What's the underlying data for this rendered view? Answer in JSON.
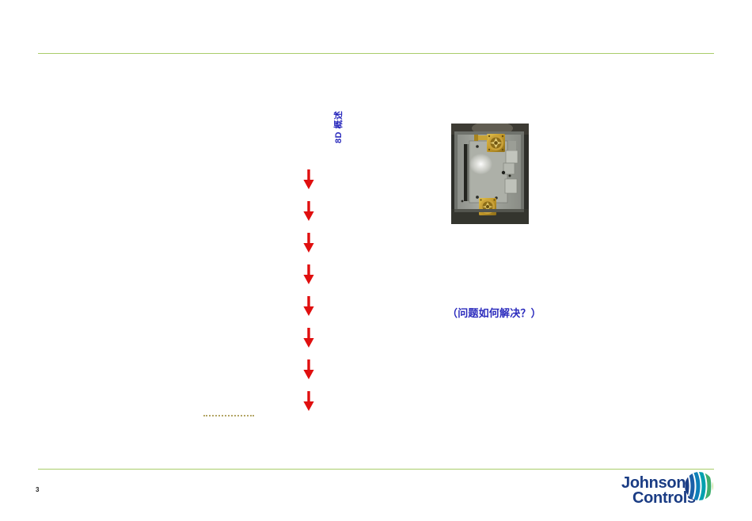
{
  "slide": {
    "page_number": "3",
    "vertical_heading": "8D 概述",
    "caption": "（问题如何解决？）",
    "ellipsis_marker": "",
    "arrow_count": 8,
    "colors": {
      "rule_green": "#a9cd6a",
      "arrow_red": "#e00f0f",
      "heading_blue": "#2b2bbd",
      "caption_blue": "#2b2bbd",
      "dotted_tan": "#b3a565",
      "logo_blue": "#1a3c84",
      "logo_mark_green": "#7ab800",
      "logo_mark_teal": "#00a0af"
    }
  },
  "logo": {
    "line1": "Johnson",
    "line2": "Controls",
    "mark_name": "johnson-controls-globe-mark"
  },
  "photo": {
    "alt": "metal housing plate with two brass fittings",
    "body_color": "#9a9c96",
    "brass_color": "#c49a2a",
    "dark_color": "#2e2f2a"
  }
}
